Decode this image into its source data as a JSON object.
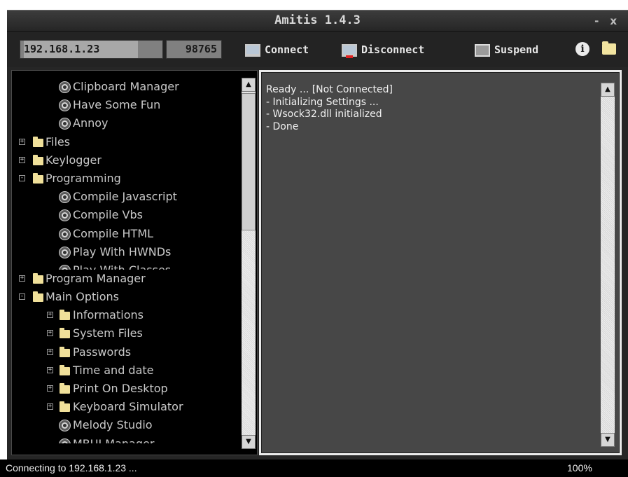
{
  "window": {
    "title": "Amitis 1.4.3",
    "minimize": "-",
    "close": "x"
  },
  "toolbar": {
    "ip": "192.168.1.23",
    "port": "98765",
    "connect_label": "Connect",
    "disconnect_label": "Disconnect",
    "suspend_label": "Suspend",
    "info_icon": "info-icon",
    "folder_icon": "folder-icon"
  },
  "tree": {
    "items": [
      {
        "label": "Clipboard Manager",
        "level": 1,
        "icon": "gear-icon"
      },
      {
        "label": "Have Some Fun",
        "level": 1,
        "icon": "gear-icon"
      },
      {
        "label": "Annoy",
        "level": 1,
        "icon": "gear-icon"
      },
      {
        "label": "Files",
        "level": 0,
        "icon": "folder-icon",
        "expander": "+"
      },
      {
        "label": "Keylogger",
        "level": 0,
        "icon": "folder-icon",
        "expander": "+"
      },
      {
        "label": "Programming",
        "level": 0,
        "icon": "folder-icon",
        "expander": "-"
      },
      {
        "label": "Compile Javascript",
        "level": 1,
        "icon": "gear-icon"
      },
      {
        "label": "Compile Vbs",
        "level": 1,
        "icon": "gear-icon"
      },
      {
        "label": "Compile HTML",
        "level": 1,
        "icon": "gear-icon"
      },
      {
        "label": "Play With HWNDs",
        "level": 1,
        "icon": "gear-icon"
      },
      {
        "label": "Play With Classes",
        "level": 1,
        "icon": "gear-icon"
      },
      {
        "label": "Program Manager",
        "level": 0,
        "icon": "folder-icon",
        "expander": "+"
      },
      {
        "label": "Main Options",
        "level": 0,
        "icon": "folder-icon",
        "expander": "-"
      },
      {
        "label": "Informations",
        "level": 1,
        "icon": "folder-icon",
        "expander": "+"
      },
      {
        "label": "System Files",
        "level": 1,
        "icon": "folder-icon",
        "expander": "+"
      },
      {
        "label": "Passwords",
        "level": 1,
        "icon": "folder-icon",
        "expander": "+"
      },
      {
        "label": "Time and date",
        "level": 1,
        "icon": "folder-icon",
        "expander": "+"
      },
      {
        "label": "Print On Desktop",
        "level": 1,
        "icon": "folder-icon",
        "expander": "+"
      },
      {
        "label": "Keyboard Simulator",
        "level": 1,
        "icon": "folder-icon",
        "expander": "+"
      },
      {
        "label": "Melody Studio",
        "level": 1,
        "icon": "gear-icon"
      },
      {
        "label": "MBUI Manager",
        "level": 1,
        "icon": "gear-icon"
      }
    ]
  },
  "log": {
    "lines": [
      "Ready ... [Not Connected]",
      "- Initializing Settings ...",
      "- Wsock32.dll initialized",
      "- Done"
    ]
  },
  "status": {
    "text": "Connecting to 192.168.1.23 ...",
    "progress": "100%"
  },
  "scroll": {
    "up_arrow": "▲",
    "down_arrow": "▼"
  }
}
